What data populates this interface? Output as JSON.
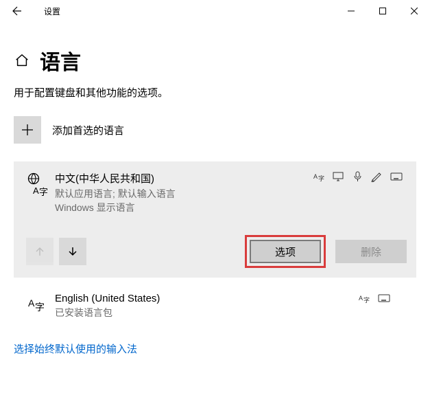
{
  "titlebar": {
    "title": "设置"
  },
  "page": {
    "heading": "语言",
    "description": "用于配置键盘和其他功能的选项。"
  },
  "add": {
    "label": "添加首选的语言"
  },
  "languages": [
    {
      "name": "中文(中华人民共和国)",
      "line1": "默认应用语言; 默认输入语言",
      "line2": "Windows 显示语言",
      "icon": "globe-az",
      "indicators": [
        "az-small",
        "display",
        "speech",
        "handwrite",
        "keyboard"
      ]
    },
    {
      "name": "English (United States)",
      "line1": "已安装语言包",
      "icon": "az",
      "indicators": [
        "az-small",
        "keyboard"
      ]
    }
  ],
  "buttons": {
    "options": "选项",
    "delete": "删除"
  },
  "link": {
    "ime": "选择始终默认使用的输入法"
  }
}
